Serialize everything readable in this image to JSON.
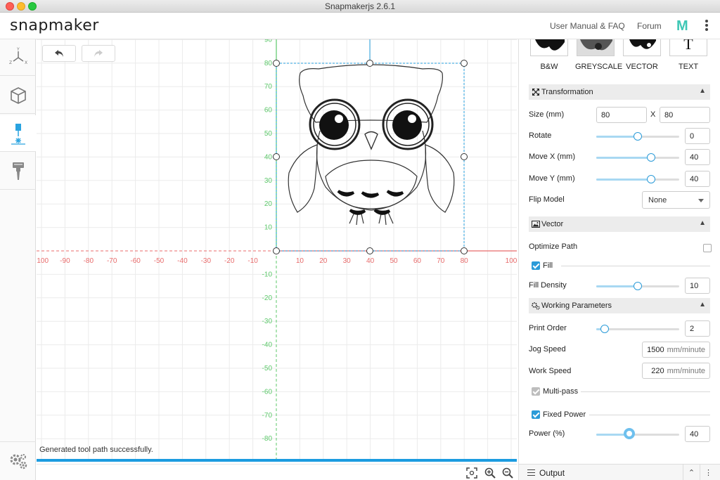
{
  "window": {
    "title": "Snapmakerjs 2.6.1"
  },
  "header": {
    "brand": "snapmaker",
    "links": [
      "User Manual & FAQ",
      "Forum"
    ],
    "m_logo": "M"
  },
  "leftbar": {
    "tools": [
      {
        "name": "axes-icon",
        "label": ""
      },
      {
        "name": "cube-icon",
        "label": ""
      },
      {
        "name": "laser-icon",
        "label": ""
      },
      {
        "name": "cnc-icon",
        "label": ""
      }
    ],
    "settings_icon": "gear-icon"
  },
  "canvas": {
    "status_message": "Generated tool path successfully.",
    "progress": 1.0,
    "x_ticks": [
      -100,
      -90,
      -80,
      -70,
      -60,
      -50,
      -40,
      -30,
      -20,
      -10,
      10,
      20,
      30,
      40,
      50,
      60,
      70,
      80,
      100
    ],
    "y_ticks_pos": [
      10,
      20,
      30,
      40,
      50,
      60,
      70,
      80,
      90
    ],
    "y_ticks_neg": [
      -10,
      -20,
      -30,
      -40,
      -50,
      -60,
      -70,
      -80
    ],
    "colors": {
      "x_axis": "#e86b6b",
      "y_axis": "#5cc86a",
      "selection": "#29a3e0",
      "grid": "#ebebeb"
    }
  },
  "panel": {
    "modes": [
      "B&W",
      "GREYSCALE",
      "VECTOR",
      "TEXT"
    ],
    "text_mode_glyph": "T",
    "transformation": {
      "title": "Transformation",
      "size_label": "Size (mm)",
      "size_w": "80",
      "size_sep": "X",
      "size_h": "80",
      "rotate_label": "Rotate",
      "rotate": "0",
      "rotate_frac": 0.5,
      "move_x_label": "Move X (mm)",
      "move_x": "40",
      "move_x_frac": 0.66,
      "move_y_label": "Move Y (mm)",
      "move_y": "40",
      "move_y_frac": 0.66,
      "flip_label": "Flip Model",
      "flip_value": "None"
    },
    "vector": {
      "title": "Vector",
      "optimize_label": "Optimize Path",
      "optimize_checked": false,
      "fill_label": "Fill",
      "fill_checked": true,
      "fill_density_label": "Fill Density",
      "fill_density": "10",
      "fill_density_frac": 0.5
    },
    "working": {
      "title": "Working Parameters",
      "print_order_label": "Print Order",
      "print_order": "2",
      "print_order_frac": 0.1,
      "jog_label": "Jog Speed",
      "jog_value": "1500",
      "jog_unit": "mm/minute",
      "work_label": "Work Speed",
      "work_value": "220",
      "work_unit": "mm/minute",
      "multipass_label": "Multi-pass",
      "multipass_checked": true,
      "fixed_power_label": "Fixed Power",
      "fixed_power_checked": true,
      "power_label": "Power (%)",
      "power": "40",
      "power_frac": 0.4
    }
  },
  "output": {
    "label": "Output"
  }
}
